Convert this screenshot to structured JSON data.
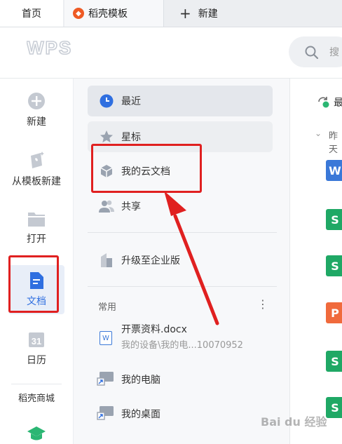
{
  "tabs": {
    "home": "首页",
    "daoke_templates": "稻壳模板",
    "new": "新建"
  },
  "header": {
    "logo": "WPS",
    "search_placeholder": "搜"
  },
  "leftnav": {
    "items": [
      {
        "label": "新建",
        "icon": "plus-circle-icon"
      },
      {
        "label": "从模板新建",
        "icon": "template-icon"
      },
      {
        "label": "打开",
        "icon": "folder-icon"
      },
      {
        "label": "文档",
        "icon": "document-icon"
      },
      {
        "label": "日历",
        "icon": "calendar-icon",
        "day": "31"
      },
      {
        "label": "稻壳商城",
        "icon": ""
      }
    ]
  },
  "midpanel": {
    "recent": "最近",
    "starred": "星标",
    "cloud_docs": "我的云文档",
    "shared": "共享",
    "upgrade": "升级至企业版",
    "common_section": "常用",
    "more": "⋮",
    "recent_file": {
      "name": "开票资料.docx",
      "path": "我的设备\\我的电...10070952"
    },
    "my_computer": "我的电脑",
    "my_desktop": "我的桌面"
  },
  "rightpanel": {
    "top_label": "最",
    "yesterday_label": "昨天",
    "file_icons": [
      {
        "letter": "W",
        "color": "#3a78d8"
      },
      {
        "letter": "S",
        "color": "#1fa865"
      },
      {
        "letter": "S",
        "color": "#1fa865"
      },
      {
        "letter": "P",
        "color": "#f06a3c"
      },
      {
        "letter": "S",
        "color": "#1fa865"
      },
      {
        "letter": "S",
        "color": "#1fa865"
      }
    ]
  },
  "watermark": "Bai du 经验",
  "colors": {
    "annotation_red": "#e02020",
    "wps_blue": "#3a78d8",
    "sheet_green": "#1fa865",
    "ppt_orange": "#f06a3c"
  }
}
